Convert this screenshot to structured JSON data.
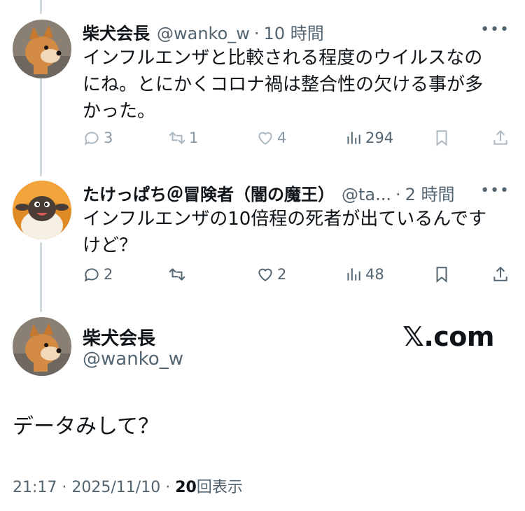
{
  "tweets": [
    {
      "name": "柴犬会長",
      "handle": "@wanko_w",
      "sep": "·",
      "time": "10 時間",
      "text": "インフルエンザと比較される程度のウイルスなのにね。とにかくコロナ禍は整合性の欠ける事が多かった。",
      "replies": "3",
      "retweets": "1",
      "likes": "4",
      "views": "294",
      "avatar_icon": "shiba-dog-avatar"
    },
    {
      "name": "たけっぱち＠冒険者（闇の魔王）",
      "handle": "@ta...",
      "sep": "·",
      "time": "2 時間",
      "text": "インフルエンザの10倍程の死者が出ているんですけど？",
      "replies": "2",
      "retweets": "",
      "likes": "2",
      "views": "48",
      "avatar_icon": "sheep-avatar"
    }
  ],
  "main": {
    "name": "柴犬会長",
    "handle": "@wanko_w",
    "text": "データみして？",
    "time": "21:17",
    "date": "2025/11/10",
    "sep": "·",
    "views_count": "20",
    "views_label": "回表示",
    "watermark": "𝕏.com"
  },
  "more_label": "•••",
  "icons": [
    "reply-icon",
    "retweet-icon",
    "like-icon",
    "views-icon",
    "bookmark-icon",
    "share-icon",
    "more-icon"
  ],
  "colors": {
    "text": "#0f1419",
    "secondary": "#536471",
    "line": "#cfd9de"
  }
}
